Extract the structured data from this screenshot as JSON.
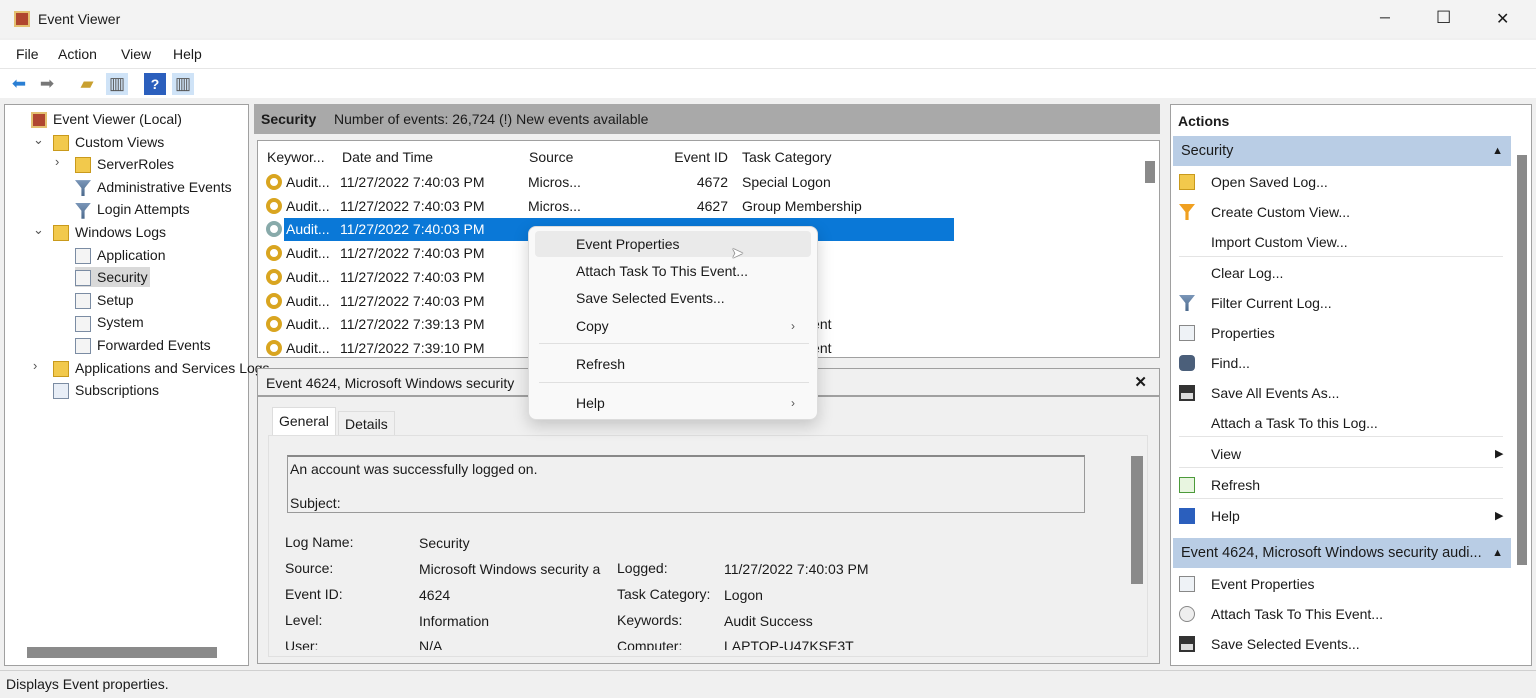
{
  "window": {
    "title": "Event Viewer",
    "minimize": "─",
    "maximize": "☐",
    "close": "✕"
  },
  "menu": [
    "File",
    "Action",
    "View",
    "Help"
  ],
  "tree": [
    {
      "label": "Event Viewer (Local)",
      "icon": "event-viewer-icon",
      "level": 0
    },
    {
      "label": "Custom Views",
      "icon": "folder-icon",
      "level": 1,
      "expander": "⌄"
    },
    {
      "label": "ServerRoles",
      "icon": "folder-icon",
      "level": 2,
      "expander": "›"
    },
    {
      "label": "Administrative Events",
      "icon": "filter-icon",
      "level": 2
    },
    {
      "label": "Login Attempts",
      "icon": "filter-icon",
      "level": 2
    },
    {
      "label": "Windows Logs",
      "icon": "folder-icon",
      "level": 1,
      "expander": "⌄"
    },
    {
      "label": "Application",
      "icon": "log-icon",
      "level": 2
    },
    {
      "label": "Security",
      "icon": "log-icon",
      "level": 2,
      "selected": true
    },
    {
      "label": "Setup",
      "icon": "log-icon",
      "level": 2
    },
    {
      "label": "System",
      "icon": "log-icon",
      "level": 2
    },
    {
      "label": "Forwarded Events",
      "icon": "log-icon",
      "level": 2
    },
    {
      "label": "Applications and Services Logs",
      "icon": "folder-icon",
      "level": 1,
      "expander": "›"
    },
    {
      "label": "Subscriptions",
      "icon": "subscriptions-icon",
      "level": 1
    }
  ],
  "center": {
    "log_name": "Security",
    "summary": "Number of events: 26,724 (!) New events available"
  },
  "table": {
    "columns": [
      "Keywor...",
      "Date and Time",
      "Source",
      "Event ID",
      "Task Category"
    ],
    "rows": [
      {
        "keyword": "Audit...",
        "date": "11/27/2022 7:40:03 PM",
        "source": "Micros...",
        "id": "4672",
        "task": "Special Logon"
      },
      {
        "keyword": "Audit...",
        "date": "11/27/2022 7:40:03 PM",
        "source": "Micros...",
        "id": "4627",
        "task": "Group Membership"
      },
      {
        "keyword": "Audit...",
        "date": "11/27/2022 7:40:03 PM",
        "source": "",
        "id": "",
        "task": "",
        "selected": true
      },
      {
        "keyword": "Audit...",
        "date": "11/27/2022 7:40:03 PM",
        "source": "",
        "id": "",
        "task": "on"
      },
      {
        "keyword": "Audit...",
        "date": "11/27/2022 7:40:03 PM",
        "source": "",
        "id": "",
        "task": "bership"
      },
      {
        "keyword": "Audit...",
        "date": "11/27/2022 7:40:03 PM",
        "source": "",
        "id": "",
        "task": ""
      },
      {
        "keyword": "Audit...",
        "date": "11/27/2022 7:39:13 PM",
        "source": "",
        "id": "",
        "task": "t Management"
      },
      {
        "keyword": "Audit...",
        "date": "11/27/2022 7:39:10 PM",
        "source": "",
        "id": "",
        "task": "t Management"
      }
    ]
  },
  "context_menu": [
    {
      "label": "Event Properties",
      "hover": true
    },
    {
      "label": "Attach Task To This Event..."
    },
    {
      "label": "Save Selected Events..."
    },
    {
      "label": "Copy",
      "submenu": "›"
    },
    {
      "label": "Refresh"
    },
    {
      "label": "Help",
      "submenu": "›"
    }
  ],
  "detail": {
    "title": "Event 4624, Microsoft Windows security",
    "close": "✕",
    "tabs": [
      "General",
      "Details"
    ],
    "message_line1": "An account was successfully logged on.",
    "message_line2": "Subject:",
    "fields": {
      "log_name_label": "Log Name:",
      "log_name": "Security",
      "source_label": "Source:",
      "source": "Microsoft Windows security a",
      "logged_label": "Logged:",
      "logged": "11/27/2022 7:40:03 PM",
      "event_id_label": "Event ID:",
      "event_id": "4624",
      "task_label": "Task Category:",
      "task": "Logon",
      "level_label": "Level:",
      "level": "Information",
      "keywords_label": "Keywords:",
      "keywords": "Audit Success",
      "user_label": "User:",
      "user": "N/A",
      "computer_label": "Computer:",
      "computer": "LAPTOP-U47KSE3T"
    }
  },
  "actions": {
    "title": "Actions",
    "section1": "Security",
    "items1": [
      {
        "label": "Open Saved Log...",
        "icon": "open-folder-icon"
      },
      {
        "label": "Create Custom View...",
        "icon": "create-filter-icon"
      },
      {
        "label": "Import Custom View...",
        "icon": ""
      },
      {
        "label": "Clear Log...",
        "icon": ""
      },
      {
        "label": "Filter Current Log...",
        "icon": "filter-icon"
      },
      {
        "label": "Properties",
        "icon": "properties-icon"
      },
      {
        "label": "Find...",
        "icon": "binoculars-icon"
      },
      {
        "label": "Save All Events As...",
        "icon": "save-icon"
      },
      {
        "label": "Attach a Task To this Log...",
        "icon": ""
      },
      {
        "label": "View",
        "icon": "",
        "submenu": "▶"
      },
      {
        "label": "Refresh",
        "icon": "refresh-icon"
      },
      {
        "label": "Help",
        "icon": "help-icon",
        "submenu": "▶"
      }
    ],
    "section2": "Event 4624, Microsoft Windows security audi...",
    "items2": [
      {
        "label": "Event Properties",
        "icon": "properties-icon"
      },
      {
        "label": "Attach Task To This Event...",
        "icon": "task-icon"
      },
      {
        "label": "Save Selected Events...",
        "icon": "save-icon"
      }
    ]
  },
  "status": "Displays Event properties."
}
